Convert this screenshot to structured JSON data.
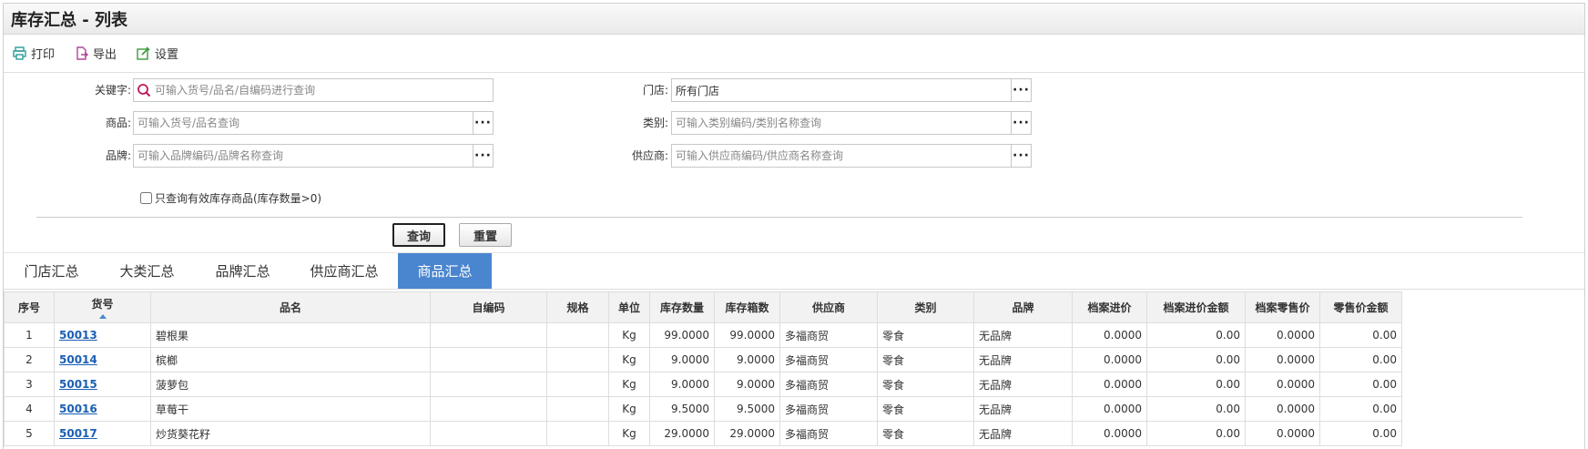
{
  "window": {
    "title": "库存汇总 - 列表"
  },
  "toolbar": {
    "print": "打印",
    "export": "导出",
    "settings": "设置"
  },
  "form": {
    "keyword_label": "关键字:",
    "keyword_placeholder": "可输入货号/品名/自编码进行查询",
    "store_label": "门店:",
    "store_value": "所有门店",
    "product_label": "商品:",
    "product_placeholder": "可输入货号/品名查询",
    "category_label": "类别:",
    "category_placeholder": "可输入类别编码/类别名称查询",
    "brand_label": "品牌:",
    "brand_placeholder": "可输入品牌编码/品牌名称查询",
    "supplier_label": "供应商:",
    "supplier_placeholder": "可输入供应商编码/供应商名称查询",
    "dots": "···",
    "only_valid_label": "只查询有效库存商品(库存数量>0)",
    "query_button": "查询",
    "reset_button": "重置"
  },
  "tabs": [
    "门店汇总",
    "大类汇总",
    "品牌汇总",
    "供应商汇总",
    "商品汇总"
  ],
  "active_tab": 4,
  "table": {
    "headers": [
      "序号",
      "货号",
      "品名",
      "自编码",
      "规格",
      "单位",
      "库存数量",
      "库存箱数",
      "供应商",
      "类别",
      "品牌",
      "档案进价",
      "档案进价金额",
      "档案零售价",
      "零售价金额"
    ],
    "rows": [
      [
        "1",
        "50013",
        "碧根果",
        "",
        "",
        "Kg",
        "99.0000",
        "99.0000",
        "多福商贸",
        "零食",
        "无品牌",
        "0.0000",
        "0.00",
        "0.0000",
        "0.00"
      ],
      [
        "2",
        "50014",
        "槟榔",
        "",
        "",
        "Kg",
        "9.0000",
        "9.0000",
        "多福商贸",
        "零食",
        "无品牌",
        "0.0000",
        "0.00",
        "0.0000",
        "0.00"
      ],
      [
        "3",
        "50015",
        "菠萝包",
        "",
        "",
        "Kg",
        "9.0000",
        "9.0000",
        "多福商贸",
        "零食",
        "无品牌",
        "0.0000",
        "0.00",
        "0.0000",
        "0.00"
      ],
      [
        "4",
        "50016",
        "草莓干",
        "",
        "",
        "Kg",
        "9.5000",
        "9.5000",
        "多福商贸",
        "零食",
        "无品牌",
        "0.0000",
        "0.00",
        "0.0000",
        "0.00"
      ],
      [
        "5",
        "50017",
        "炒货葵花籽",
        "",
        "",
        "Kg",
        "29.0000",
        "29.0000",
        "多福商贸",
        "零食",
        "无品牌",
        "0.0000",
        "0.00",
        "0.0000",
        "0.00"
      ]
    ]
  },
  "colors": {
    "tab_active": "#4a86cf",
    "link": "#1a5fb4",
    "print_icon": "#2a9d9d",
    "export_icon": "#b0479a",
    "settings_icon": "#3a9a3a",
    "search_icon": "#c2185b"
  }
}
